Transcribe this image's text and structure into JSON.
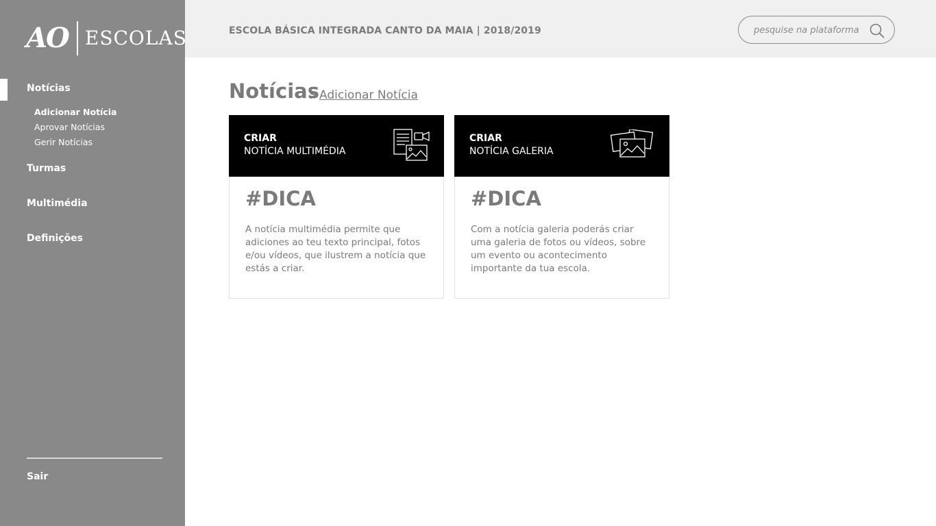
{
  "brand": {
    "logo_ao": "AO",
    "logo_escolas": "ESCOLAS"
  },
  "sidebar": {
    "items": [
      {
        "label": "Notícias",
        "active": true,
        "children": [
          {
            "label": "Adicionar Notícia",
            "active": true
          },
          {
            "label": "Aprovar Notícias"
          },
          {
            "label": "Gerir Notícias"
          }
        ]
      },
      {
        "label": "Turmas"
      },
      {
        "label": "Multimédia"
      },
      {
        "label": "Definições"
      }
    ],
    "logout": "Sair"
  },
  "header": {
    "school": "ESCOLA BÁSICA INTEGRADA CANTO DA MAIA  | 2018/2019",
    "search_placeholder": "pesquise na plataforma",
    "search_icon": "search-icon"
  },
  "page": {
    "title": "Notícias",
    "breadcrumb_sep": ">",
    "breadcrumb_current": "Adicionar Notícia"
  },
  "cards": [
    {
      "line1": "CRIAR",
      "line2": "NOTÍCIA MULTIMÉDIA",
      "icon": "multimedia-news-icon",
      "tip": "#DICA",
      "body": "A notícia multimédia permite que adiciones ao teu texto principal,  fotos e/ou vídeos, que ilustrem a notícia que estás a criar."
    },
    {
      "line1": "CRIAR",
      "line2": "NOTÍCIA GALERIA",
      "icon": "gallery-icon",
      "tip": "#DICA",
      "body": "Com a notícia galeria poderás criar uma galeria de fotos ou vídeos, sobre um evento ou acontecimento importante da tua escola."
    }
  ],
  "colors": {
    "sidebar": "#898989",
    "header": "#f0f0f0",
    "card_head": "#000000",
    "text_gray": "#7a7a7a"
  }
}
